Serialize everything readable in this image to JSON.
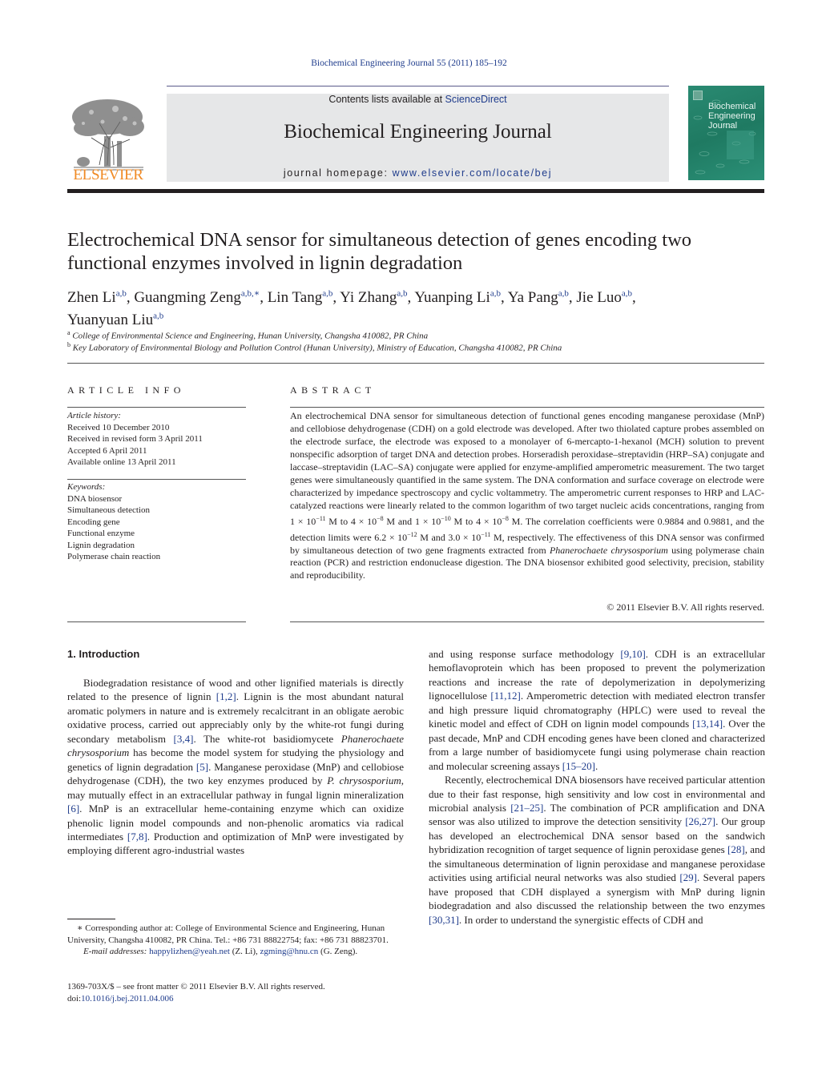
{
  "header": {
    "running_head": "Biochemical Engineering Journal 55 (2011) 185–192",
    "publisher_logo_icon": "elsevier-tree-logo",
    "publisher_name": "ELSEVIER",
    "contents_prefix": "Contents lists available at ",
    "contents_link": "ScienceDirect",
    "journal_name": "Biochemical Engineering Journal",
    "homepage_prefix": "journal homepage: ",
    "homepage_link": "www.elsevier.com/locate/bej",
    "cover_title_lines": [
      "Biochemical",
      "Engineering",
      "Journal"
    ],
    "colors": {
      "link": "#1f3c8c",
      "elsevier_orange": "#f08a24",
      "masthead_bg": "#e6e7e8",
      "cover_green": "#1f7a62"
    }
  },
  "article": {
    "title": "Electrochemical DNA sensor for simultaneous detection of genes encoding two functional enzymes involved in lignin degradation",
    "authors": [
      {
        "name": "Zhen Li",
        "sup": "a,b",
        "sep": ", "
      },
      {
        "name": "Guangming Zeng",
        "sup": "a,b,∗",
        "sep": ", "
      },
      {
        "name": "Lin Tang",
        "sup": "a,b",
        "sep": ", "
      },
      {
        "name": "Yi Zhang",
        "sup": "a,b",
        "sep": ", "
      },
      {
        "name": "Yuanping Li",
        "sup": "a,b",
        "sep": ", "
      },
      {
        "name": "Ya Pang",
        "sup": "a,b",
        "sep": ", "
      },
      {
        "name": "Jie Luo",
        "sup": "a,b",
        "sep": ","
      },
      {
        "name": "Yuanyuan Liu",
        "sup": "a,b",
        "sep": ""
      }
    ],
    "affiliations": [
      {
        "mark": "a",
        "text": "College of Environmental Science and Engineering, Hunan University, Changsha 410082, PR China"
      },
      {
        "mark": "b",
        "text": "Key Laboratory of Environmental Biology and Pollution Control (Hunan University), Ministry of Education, Changsha 410082, PR China"
      }
    ]
  },
  "article_info": {
    "heading": "ARTICLE INFO",
    "history_label": "Article history:",
    "history": [
      "Received 10 December 2010",
      "Received in revised form 3 April 2011",
      "Accepted 6 April 2011",
      "Available online 13 April 2011"
    ],
    "keywords_label": "Keywords:",
    "keywords": [
      "DNA biosensor",
      "Simultaneous detection",
      "Encoding gene",
      "Functional enzyme",
      "Lignin degradation",
      "Polymerase chain reaction"
    ]
  },
  "abstract": {
    "heading": "ABSTRACT",
    "part1": "An electrochemical DNA sensor for simultaneous detection of functional genes encoding manganese peroxidase (MnP) and cellobiose dehydrogenase (CDH) on a gold electrode was developed. After two thiolated capture probes assembled on the electrode surface, the electrode was exposed to a monolayer of 6-mercapto-1-hexanol (MCH) solution to prevent nonspecific adsorption of target DNA and detection probes. Horseradish peroxidase–streptavidin (HRP–SA) conjugate and laccase–streptavidin (LAC–SA) conjugate were applied for enzyme-amplified amperometric measurement. The two target genes were simultaneously quantified in the same system. The DNA conformation and surface coverage on electrode were characterized by impedance spectroscopy and cyclic voltammetry. The amperometric current responses to HRP and LAC-catalyzed reactions were linearly related to the common logarithm of two target nucleic acids concentrations, ranging from ",
    "range1_from": "1 × 10",
    "range1_from_exp": "−11",
    "range1_to": " M to 4 × 10",
    "range1_to_exp": "−8",
    "range2_from": " M and 1 × 10",
    "range2_from_exp": "−10",
    "range2_to": " M to 4 × 10",
    "range2_to_exp": "−8",
    "part2": " M. The correlation coefficients were 0.9884 and 0.9881, and the detection limits were 6.2 × 10",
    "limit1_exp": "−12",
    "part3": " M and 3.0 × 10",
    "limit2_exp": "−11",
    "part4": " M, respectively. The effectiveness of this DNA sensor was confirmed by simultaneous detection of two gene fragments extracted from ",
    "species": "Phanerochaete chrysosporium",
    "part5": " using polymerase chain reaction (PCR) and restriction endonuclease digestion. The DNA biosensor exhibited good selectivity, precision, stability and reproducibility.",
    "copyright": "© 2011 Elsevier B.V. All rights reserved."
  },
  "body": {
    "section_heading": "1.  Introduction",
    "left_column": [
      {
        "t": "Biodegradation resistance of wood and other lignified materials is directly related to the presence of lignin "
      },
      {
        "c": "[1,2]"
      },
      {
        "t": ". Lignin is the most abundant natural aromatic polymers in nature and is extremely recalcitrant in an obligate aerobic oxidative process, carried out appreciably only by the white-rot fungi during secondary metabolism "
      },
      {
        "c": "[3,4]"
      },
      {
        "t": ". The white-rot basidiomycete "
      },
      {
        "i": "Phanerochaete chrysosporium"
      },
      {
        "t": " has become the model system for studying the physiology and genetics of lignin degradation "
      },
      {
        "c": "[5]"
      },
      {
        "t": ". Manganese peroxidase (MnP) and cellobiose dehydrogenase (CDH), the two key enzymes produced by "
      },
      {
        "i": "P. chrysosporium"
      },
      {
        "t": ", may mutually effect in an extracellular pathway in fungal lignin mineralization "
      },
      {
        "c": "[6]"
      },
      {
        "t": ". MnP is an extracellular heme-containing enzyme which can oxidize phenolic lignin model compounds and non-phenolic aromatics via radical intermediates "
      },
      {
        "c": "[7,8]"
      },
      {
        "t": ". Production and optimization of MnP were investigated by employing different agro-industrial wastes"
      }
    ],
    "right_column_p1": [
      {
        "t": "and using response surface methodology "
      },
      {
        "c": "[9,10]"
      },
      {
        "t": ". CDH is an extracellular hemoflavoprotein which has been proposed to prevent the polymerization reactions and increase the rate of depolymerization in depolymerizing lignocellulose "
      },
      {
        "c": "[11,12]"
      },
      {
        "t": ". Amperometric detection with mediated electron transfer and high pressure liquid chromatography (HPLC) were used to reveal the kinetic model and effect of CDH on lignin model compounds "
      },
      {
        "c": "[13,14]"
      },
      {
        "t": ". Over the past decade, MnP and CDH encoding genes have been cloned and characterized from a large number of basidiomycete fungi using polymerase chain reaction and molecular screening assays "
      },
      {
        "c": "[15–20]"
      },
      {
        "t": "."
      }
    ],
    "right_column_p2": [
      {
        "t": "Recently, electrochemical DNA biosensors have received particular attention due to their fast response, high sensitivity and low cost in environmental and microbial analysis "
      },
      {
        "c": "[21–25]"
      },
      {
        "t": ". The combination of PCR amplification and DNA sensor was also utilized to improve the detection sensitivity "
      },
      {
        "c": "[26,27]"
      },
      {
        "t": ". Our group has developed an electrochemical DNA sensor based on the sandwich hybridization recognition of target sequence of lignin peroxidase genes "
      },
      {
        "c": "[28]"
      },
      {
        "t": ", and the simultaneous determination of lignin peroxidase and manganese peroxidase activities using artificial neural networks was also studied "
      },
      {
        "c": "[29]"
      },
      {
        "t": ". Several papers have proposed that CDH displayed a synergism with MnP during lignin biodegradation and also discussed the relationship between the two enzymes "
      },
      {
        "c": "[30,31]"
      },
      {
        "t": ". In order to understand the synergistic effects of CDH and"
      }
    ]
  },
  "footnotes": {
    "corresponding": "∗ Corresponding author at: College of Environmental Science and Engineering, Hunan University, Changsha 410082, PR China. Tel.: +86 731 88822754; fax: +86 731 88823701.",
    "email_label": "E-mail addresses:",
    "email1": "happylizhen@yeah.net",
    "email1_owner": " (Z. Li), ",
    "email2": "zgming@hnu.cn",
    "email2_owner": " (G. Zeng).",
    "front_matter": "1369-703X/$ – see front matter © 2011 Elsevier B.V. All rights reserved.",
    "doi_prefix": "doi:",
    "doi": "10.1016/j.bej.2011.04.006"
  }
}
